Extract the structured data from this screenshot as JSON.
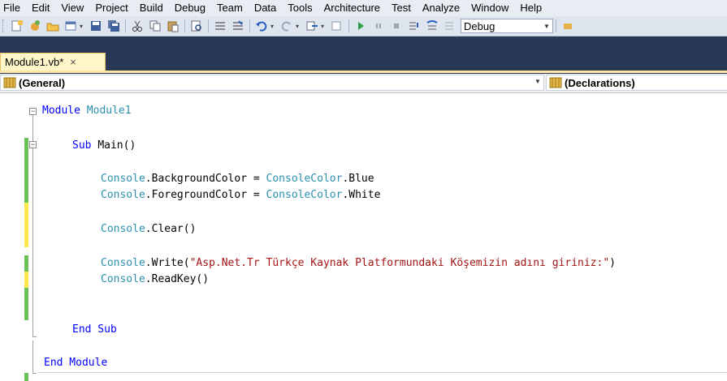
{
  "menu": [
    "File",
    "Edit",
    "View",
    "Project",
    "Build",
    "Debug",
    "Team",
    "Data",
    "Tools",
    "Architecture",
    "Test",
    "Analyze",
    "Window",
    "Help"
  ],
  "toolbar": {
    "config_value": "Debug",
    "icons": [
      "new-project-icon",
      "add-item-icon",
      "open-file-icon",
      "add-new-item-icon",
      "save-icon",
      "save-all-icon",
      "cut-icon",
      "copy-icon",
      "paste-icon",
      "find-icon",
      "comment-icon",
      "uncomment-icon",
      "undo-icon",
      "redo-icon",
      "navigate-backward-icon",
      "navigate-forward-icon",
      "start-icon",
      "pause-icon",
      "stop-icon",
      "step-into-icon",
      "step-over-icon",
      "step-out-icon"
    ]
  },
  "tab": {
    "label": "Module1.vb*",
    "close": "×"
  },
  "navbar": {
    "left": "(General)",
    "right": "(Declarations)"
  },
  "code": {
    "line1_kw": "Module",
    "line1_name": "Module1",
    "line2_kw": "Sub",
    "line2_rest": "Main()",
    "line3_obj": "Console",
    "line3_prop": ".BackgroundColor = ",
    "line3_type": "ConsoleColor",
    "line3_val": ".Blue",
    "line4_obj": "Console",
    "line4_prop": ".ForegroundColor = ",
    "line4_type": "ConsoleColor",
    "line4_val": ".White",
    "line5_obj": "Console",
    "line5_call": ".Clear()",
    "line6_obj": "Console",
    "line6_call": ".Write(",
    "line6_str": "\"Asp.Net.Tr Türkçe Kaynak Platformundaki Köşemizin adını giriniz:\"",
    "line6_end": ")",
    "line7_obj": "Console",
    "line7_call": ".ReadKey()",
    "line8": "End Sub",
    "line9": "End Module"
  },
  "colors": {
    "keyword": "#0000ff",
    "type": "#2b91af",
    "string": "#a31515",
    "saved_change": "#6ac259",
    "unsaved_change": "#ffe84d"
  }
}
